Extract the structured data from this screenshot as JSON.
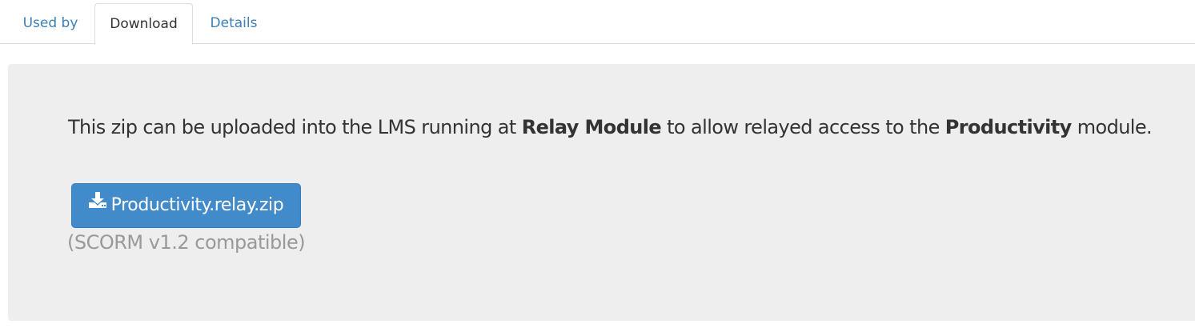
{
  "tabs": {
    "used_by": "Used by",
    "download": "Download",
    "details": "Details",
    "active": "Download"
  },
  "content": {
    "text_part1": "This zip can be uploaded into the LMS running at ",
    "relay_module": "Relay Module",
    "text_part2": " to allow relayed access to the ",
    "module_name": "Productivity",
    "text_part3": " module.",
    "download_button_label": "Productivity.relay.zip",
    "download_icon": "download-icon",
    "compat_note": "(SCORM v1.2 compatible)"
  },
  "colors": {
    "accent": "#428bca",
    "link": "#3c7fb8",
    "well_background": "#eeeeee",
    "muted_text": "#999999"
  }
}
